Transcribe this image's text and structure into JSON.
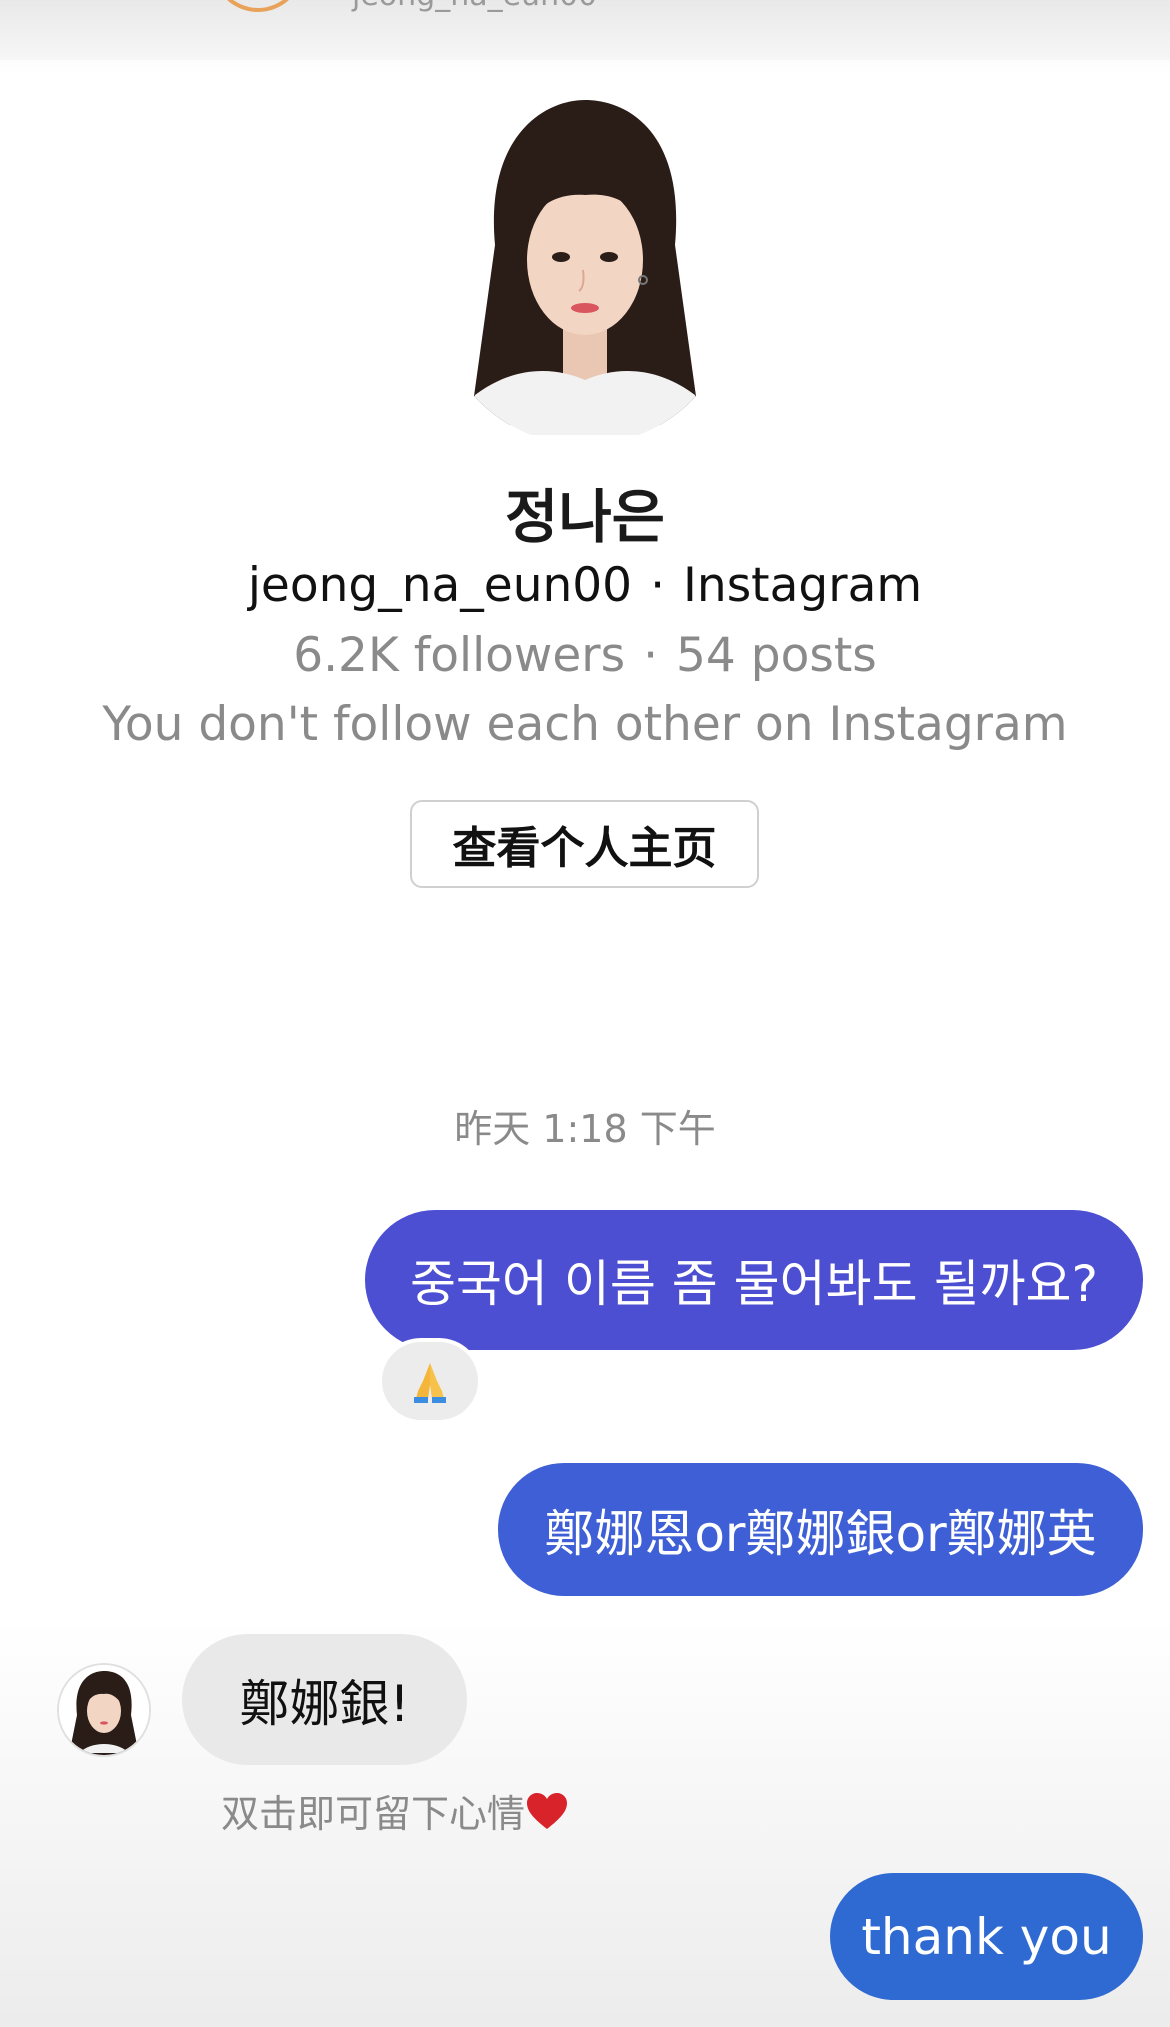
{
  "header": {
    "username": "jeong_na_eun00"
  },
  "profile": {
    "display_name": "정나은",
    "username": "jeong_na_eun00",
    "platform": "Instagram",
    "followers": "6.2K followers",
    "posts": "54 posts",
    "follow_status": "You don't follow each other on Instagram",
    "view_profile_label": "查看个人主页"
  },
  "chat": {
    "timestamp": "昨天 1:18 下午",
    "messages": [
      {
        "direction": "outgoing",
        "text": "중국어 이름 좀 물어봐도 될까요?",
        "reaction": "🙏"
      },
      {
        "direction": "outgoing",
        "text": "鄭娜恩or鄭娜銀or鄭娜英"
      },
      {
        "direction": "incoming",
        "text": "鄭娜銀!"
      },
      {
        "direction": "outgoing",
        "text": "thank you"
      }
    ],
    "double_tap_hint": "双击即可留下心情",
    "icons": {
      "reaction": "praying-hands-icon",
      "hint": "red-heart-icon"
    }
  },
  "colors": {
    "bubble_1": "#4c4fd2",
    "bubble_2": "#3e5fd6",
    "bubble_3": "#2f6ad2",
    "incoming_bubble": "#e9e9e9",
    "heart": "#d8232a"
  }
}
